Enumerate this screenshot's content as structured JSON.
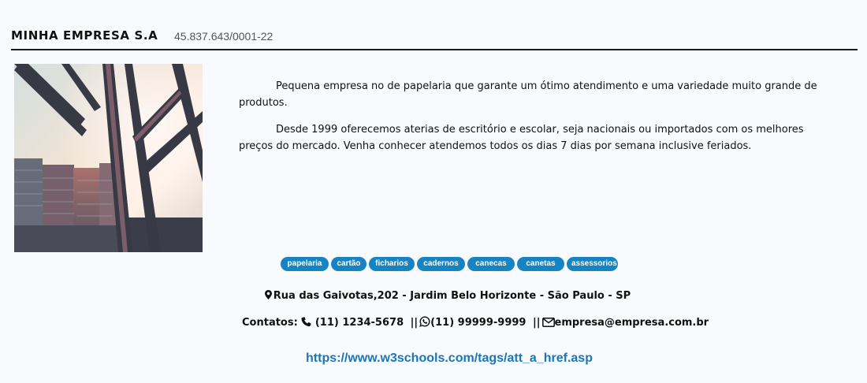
{
  "header": {
    "company_name": "MINHA EMPRESA S.A",
    "cnpj": "45.837.643/0001-22"
  },
  "description": {
    "paragraph_1": "Pequena empresa no de papelaria que garante um ótimo atendimento e uma variedade muito grande de produtos.",
    "paragraph_2": "Desde 1999 oferecemos aterias de escritório e escolar, seja nacionais ou importados com os melhores preços do mercado. Venha conhecer atendemos todos os dias 7 dias por semana inclusive feriados."
  },
  "tags": [
    "papelaria",
    "cartão",
    "ficharios",
    "cadernos",
    "canecas",
    "canetas",
    "assessorios"
  ],
  "address": {
    "icon": "map-marker-icon",
    "text": "Rua das Gaivotas,202 - Jardim Belo Horizonte - São Paulo - SP"
  },
  "contacts": {
    "label": "Contatos:",
    "phone_icon": "phone-icon",
    "phone": "(11) 1234-5678",
    "separator": "||",
    "whatsapp_icon": "whatsapp-icon",
    "whatsapp": "(11) 99999-9999",
    "email_icon": "envelope-icon",
    "email": "empresa@empresa.com.br"
  },
  "link": {
    "text": "https://www.w3schools.com/tags/att_a_href.asp"
  },
  "colors": {
    "tag_background": "#1684c2",
    "link": "#1976b7",
    "background": "#f9fafe"
  }
}
